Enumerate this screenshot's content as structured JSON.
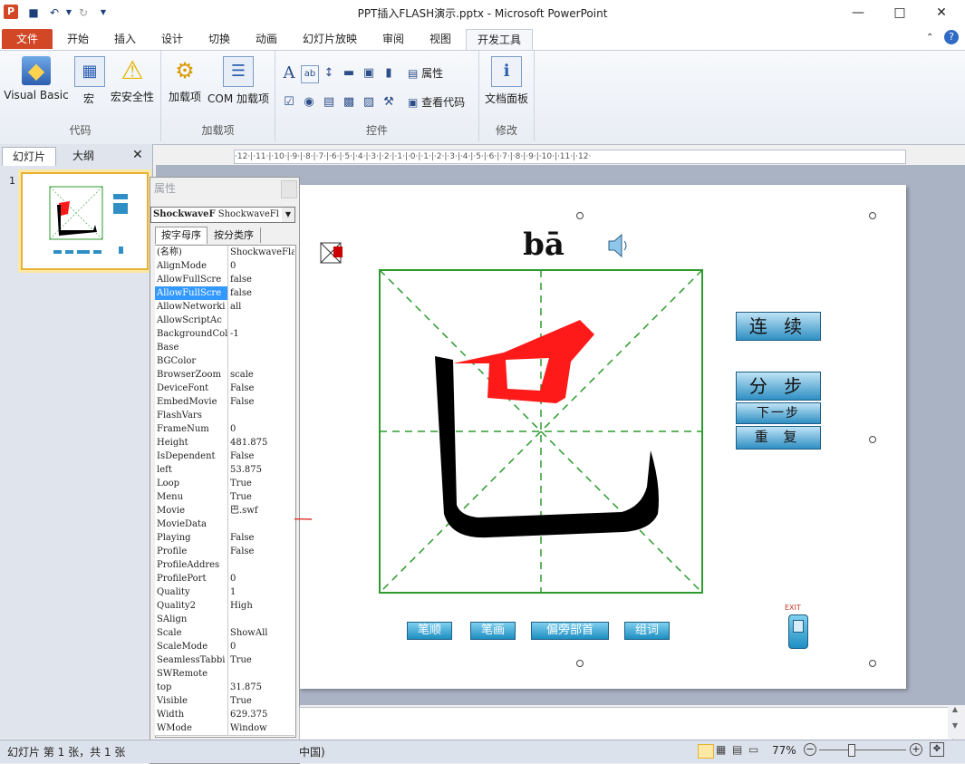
{
  "window": {
    "title": "PPT插入FLASH演示.pptx - Microsoft PowerPoint"
  },
  "tabs": [
    {
      "label": "文件"
    },
    {
      "label": "开始"
    },
    {
      "label": "插入"
    },
    {
      "label": "设计"
    },
    {
      "label": "切换"
    },
    {
      "label": "动画"
    },
    {
      "label": "幻灯片放映"
    },
    {
      "label": "审阅"
    },
    {
      "label": "视图"
    },
    {
      "label": "开发工具"
    }
  ],
  "ribbon": {
    "groups": {
      "code": "代码",
      "addins": "加载项",
      "controls": "控件",
      "modify": "修改"
    },
    "buttons": {
      "visual_basic": "Visual Basic",
      "macro": "宏",
      "macro_security": "宏安全性",
      "addins": "加载项",
      "com_addins": "COM 加载项",
      "properties": "属性",
      "view_code": "查看代码",
      "doc_panel": "文档面板"
    }
  },
  "left_pane": {
    "tab_slides": "幻灯片",
    "tab_outline": "大纲",
    "slide_number": "1"
  },
  "ruler": {
    "text": "·12·|·11·|·10·|·9·|·8·|·7·|·6·|·5·|·4·|·3·|·2·|·1·|·0·|·1·|·2·|·3·|·4·|·5·|·6·|·7·|·8·|·9·|·10·|·11·|·12·"
  },
  "properties": {
    "title": "属性",
    "object_name": "ShockwaveF",
    "object_type": "ShockwaveFl",
    "tab_alpha": "按字母序",
    "tab_category": "按分类序",
    "rows": [
      {
        "name": "(名称)",
        "value": "ShockwaveFla"
      },
      {
        "name": "AlignMode",
        "value": "0"
      },
      {
        "name": "AllowFullScre",
        "value": "false"
      },
      {
        "name": "AllowFullScre",
        "value": "false"
      },
      {
        "name": "AllowNetworki",
        "value": "all"
      },
      {
        "name": "AllowScriptAc",
        "value": ""
      },
      {
        "name": "BackgroundCol",
        "value": "-1"
      },
      {
        "name": "Base",
        "value": ""
      },
      {
        "name": "BGColor",
        "value": ""
      },
      {
        "name": "BrowserZoom",
        "value": "scale"
      },
      {
        "name": "DeviceFont",
        "value": "False"
      },
      {
        "name": "EmbedMovie",
        "value": "False"
      },
      {
        "name": "FlashVars",
        "value": ""
      },
      {
        "name": "FrameNum",
        "value": "0"
      },
      {
        "name": "Height",
        "value": "481.875"
      },
      {
        "name": "IsDependent",
        "value": "False"
      },
      {
        "name": "left",
        "value": "53.875"
      },
      {
        "name": "Loop",
        "value": "True"
      },
      {
        "name": "Menu",
        "value": "True"
      },
      {
        "name": "Movie",
        "value": "巴.swf"
      },
      {
        "name": "MovieData",
        "value": ""
      },
      {
        "name": "Playing",
        "value": "False"
      },
      {
        "name": "Profile",
        "value": "False"
      },
      {
        "name": "ProfileAddres",
        "value": ""
      },
      {
        "name": "ProfilePort",
        "value": "0"
      },
      {
        "name": "Quality",
        "value": "1"
      },
      {
        "name": "Quality2",
        "value": "High"
      },
      {
        "name": "SAlign",
        "value": ""
      },
      {
        "name": "Scale",
        "value": "ShowAll"
      },
      {
        "name": "ScaleMode",
        "value": "0"
      },
      {
        "name": "SeamlessTabbi",
        "value": "True"
      },
      {
        "name": "SWRemote",
        "value": ""
      },
      {
        "name": "top",
        "value": "31.875"
      },
      {
        "name": "Visible",
        "value": "True"
      },
      {
        "name": "Width",
        "value": "629.375"
      },
      {
        "name": "WMode",
        "value": "Window"
      }
    ]
  },
  "slide": {
    "pinyin": "bā",
    "character": "巴",
    "btn_continuous": "连 续",
    "btn_step": "分 步",
    "btn_next": "下一步",
    "btn_repeat": "重 复",
    "btn_order": "笔顺",
    "btn_strokes": "笔画",
    "btn_radical": "偏旁部首",
    "btn_words": "组词",
    "exit": "EXIT"
  },
  "status": {
    "slide_info": "幻灯片 第 1 张，共 1 张",
    "lang": "中国)",
    "zoom": "77%"
  },
  "colors": {
    "file_tab": "#d24726",
    "grid_green": "#2e9b2e",
    "stroke_red": "#ff1a1a",
    "button_blue": "#2f8fc4"
  }
}
